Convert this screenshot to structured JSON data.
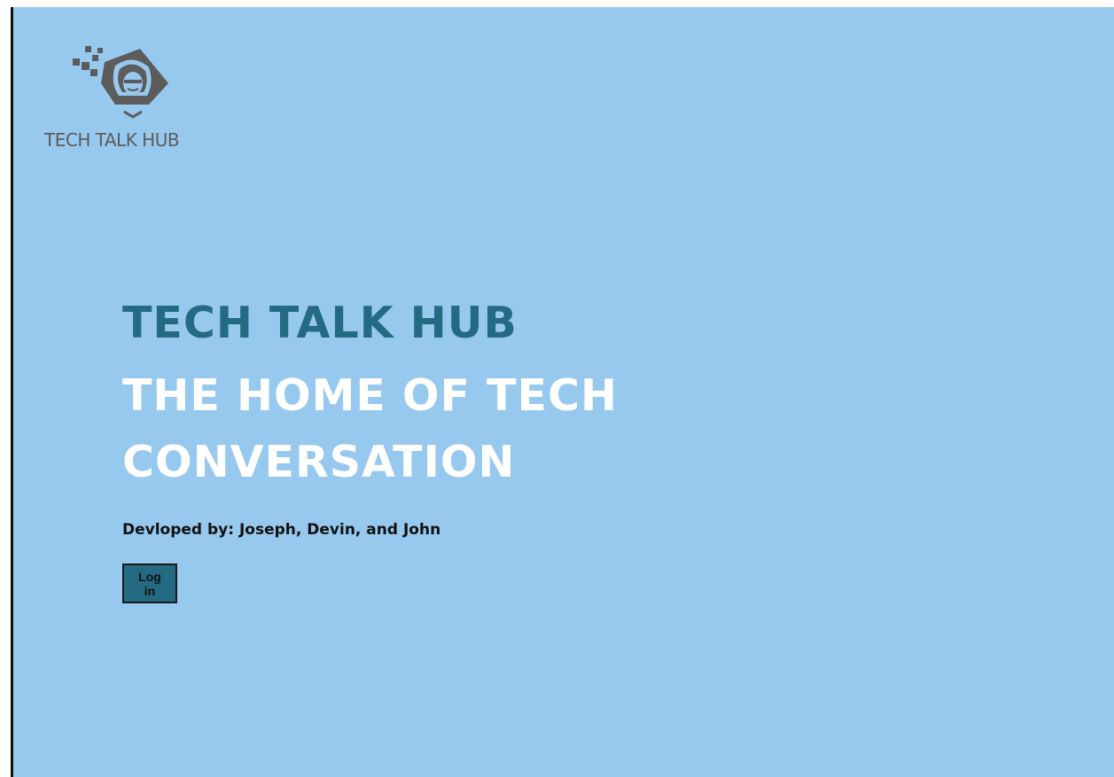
{
  "logo": {
    "text": "TECH TALK HUB",
    "icon": "hacker-face-icon"
  },
  "hero": {
    "title": "TECH TALK HUB",
    "subtitle_line1": "THE HOME OF TECH",
    "subtitle_line2": "CONVERSATION"
  },
  "credits": {
    "text": "Devloped by: Joseph, Devin, and John"
  },
  "login": {
    "label_line1": "Log",
    "label_line2": "in"
  },
  "colors": {
    "background": "#97c9ee",
    "accent": "#236a82",
    "hero_subtitle": "#ffffff",
    "logo": "#5c5c5c"
  }
}
